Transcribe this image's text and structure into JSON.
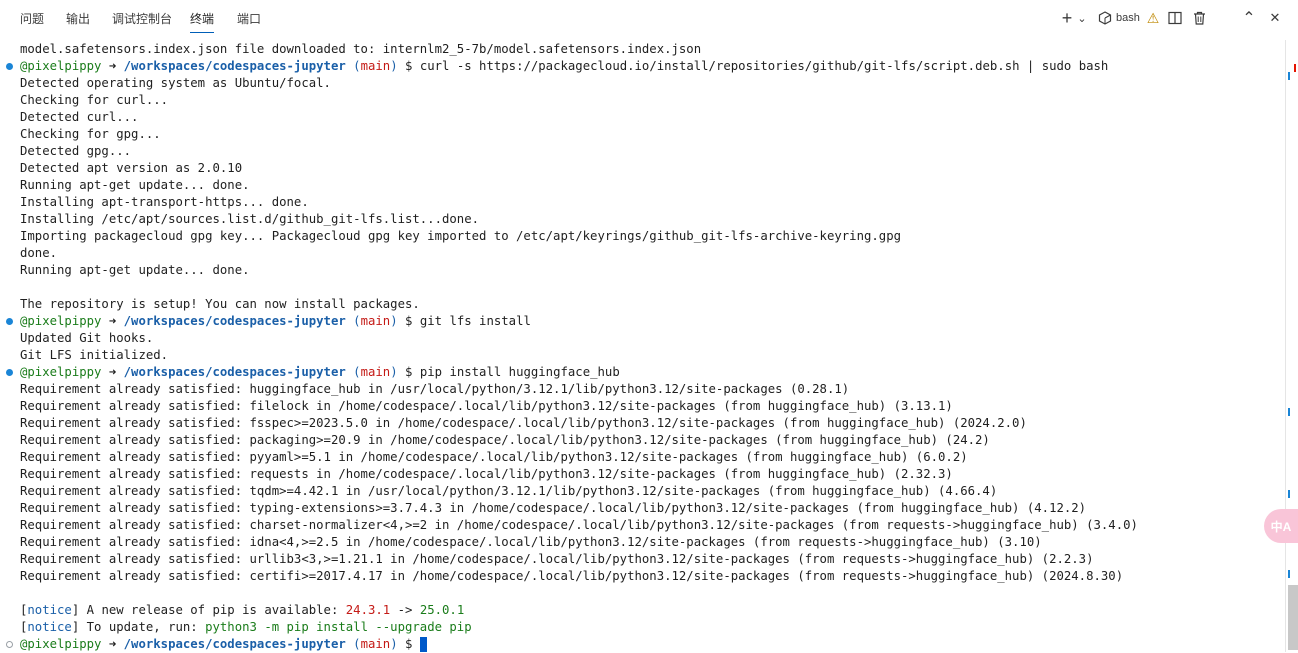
{
  "panel_tabs": [
    "问题",
    "输出",
    "调试控制台",
    "终端",
    "端口"
  ],
  "active_tab": "终端",
  "toolbar": {
    "new_terminal": "+",
    "dropdown": "⌄",
    "shell_name": "bash",
    "warning": "⚠",
    "split": "◫",
    "trash": "🗑",
    "maximize": "⌃",
    "close": "✕"
  },
  "floating_button": "中A",
  "prompt": {
    "user": "@pixelpippy",
    "arrow": "➜",
    "path": "/workspaces/codespaces-jupyter",
    "branch": "main",
    "dollar": "$"
  },
  "lines": [
    {
      "type": "text",
      "text": "model.safetensors.index.json file downloaded to: internlm2_5-7b/model.safetensors.index.json"
    },
    {
      "type": "prompt",
      "command": "curl -s https://packagecloud.io/install/repositories/github/git-lfs/script.deb.sh | sudo bash",
      "dot": "blue"
    },
    {
      "type": "text",
      "text": "Detected operating system as Ubuntu/focal."
    },
    {
      "type": "text",
      "text": "Checking for curl..."
    },
    {
      "type": "text",
      "text": "Detected curl..."
    },
    {
      "type": "text",
      "text": "Checking for gpg..."
    },
    {
      "type": "text",
      "text": "Detected gpg..."
    },
    {
      "type": "text",
      "text": "Detected apt version as 2.0.10"
    },
    {
      "type": "text",
      "text": "Running apt-get update... done."
    },
    {
      "type": "text",
      "text": "Installing apt-transport-https... done."
    },
    {
      "type": "text",
      "text": "Installing /etc/apt/sources.list.d/github_git-lfs.list...done."
    },
    {
      "type": "text",
      "text": "Importing packagecloud gpg key... Packagecloud gpg key imported to /etc/apt/keyrings/github_git-lfs-archive-keyring.gpg"
    },
    {
      "type": "text",
      "text": "done."
    },
    {
      "type": "text",
      "text": "Running apt-get update... done."
    },
    {
      "type": "text",
      "text": ""
    },
    {
      "type": "text",
      "text": "The repository is setup! You can now install packages."
    },
    {
      "type": "prompt",
      "command": "git lfs install",
      "dot": "blue"
    },
    {
      "type": "text",
      "text": "Updated Git hooks."
    },
    {
      "type": "text",
      "text": "Git LFS initialized."
    },
    {
      "type": "prompt",
      "command": "pip install huggingface_hub",
      "dot": "blue"
    },
    {
      "type": "text",
      "text": "Requirement already satisfied: huggingface_hub in /usr/local/python/3.12.1/lib/python3.12/site-packages (0.28.1)"
    },
    {
      "type": "text",
      "text": "Requirement already satisfied: filelock in /home/codespace/.local/lib/python3.12/site-packages (from huggingface_hub) (3.13.1)"
    },
    {
      "type": "text",
      "text": "Requirement already satisfied: fsspec>=2023.5.0 in /home/codespace/.local/lib/python3.12/site-packages (from huggingface_hub) (2024.2.0)"
    },
    {
      "type": "text",
      "text": "Requirement already satisfied: packaging>=20.9 in /home/codespace/.local/lib/python3.12/site-packages (from huggingface_hub) (24.2)"
    },
    {
      "type": "text",
      "text": "Requirement already satisfied: pyyaml>=5.1 in /home/codespace/.local/lib/python3.12/site-packages (from huggingface_hub) (6.0.2)"
    },
    {
      "type": "text",
      "text": "Requirement already satisfied: requests in /home/codespace/.local/lib/python3.12/site-packages (from huggingface_hub) (2.32.3)"
    },
    {
      "type": "text",
      "text": "Requirement already satisfied: tqdm>=4.42.1 in /usr/local/python/3.12.1/lib/python3.12/site-packages (from huggingface_hub) (4.66.4)"
    },
    {
      "type": "text",
      "text": "Requirement already satisfied: typing-extensions>=3.7.4.3 in /home/codespace/.local/lib/python3.12/site-packages (from huggingface_hub) (4.12.2)"
    },
    {
      "type": "text",
      "text": "Requirement already satisfied: charset-normalizer<4,>=2 in /home/codespace/.local/lib/python3.12/site-packages (from requests->huggingface_hub) (3.4.0)"
    },
    {
      "type": "text",
      "text": "Requirement already satisfied: idna<4,>=2.5 in /home/codespace/.local/lib/python3.12/site-packages (from requests->huggingface_hub) (3.10)"
    },
    {
      "type": "text",
      "text": "Requirement already satisfied: urllib3<3,>=1.21.1 in /home/codespace/.local/lib/python3.12/site-packages (from requests->huggingface_hub) (2.2.3)"
    },
    {
      "type": "text",
      "text": "Requirement already satisfied: certifi>=2017.4.17 in /home/codespace/.local/lib/python3.12/site-packages (from requests->huggingface_hub) (2024.8.30)"
    },
    {
      "type": "text",
      "text": ""
    },
    {
      "type": "notice",
      "prefix": "A new release of pip is available: ",
      "old": "24.3.1",
      "sep": " -> ",
      "new": "25.0.1"
    },
    {
      "type": "notice2",
      "prefix": "To update, run: ",
      "cmd": "python3 -m pip install --upgrade pip"
    },
    {
      "type": "prompt",
      "command": "",
      "dot": "hollow",
      "cursor": true
    }
  ],
  "notice_label": "notice"
}
